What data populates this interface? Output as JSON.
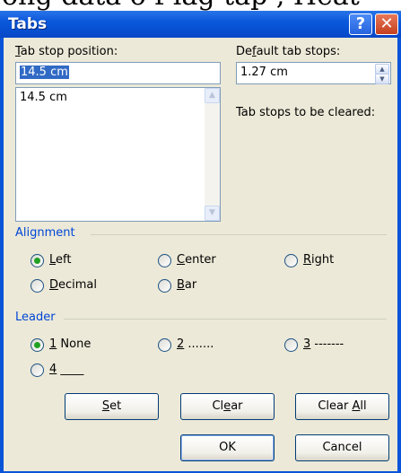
{
  "background_text": "ong data o f lag tap , Heat",
  "window": {
    "title": "Tabs",
    "help_glyph": "?",
    "close_glyph": "✕"
  },
  "tab_stop_position": {
    "label_prefix": "",
    "label_mnemonic": "T",
    "label_rest": "ab stop position:",
    "value": "14.5 cm",
    "list_items": [
      "14.5 cm"
    ]
  },
  "default_tab_stops": {
    "label_prefix": "De",
    "label_mnemonic": "f",
    "label_rest": "ault tab stops:",
    "value": "1.27 cm"
  },
  "tab_stops_cleared_label": "Tab stops to be cleared:",
  "alignment": {
    "group_label": "Alignment",
    "options": [
      {
        "mnemonic": "L",
        "rest": "eft",
        "checked": true
      },
      {
        "mnemonic": "C",
        "rest": "enter",
        "checked": false
      },
      {
        "mnemonic": "R",
        "rest": "ight",
        "checked": false
      },
      {
        "mnemonic": "D",
        "rest": "ecimal",
        "checked": false
      },
      {
        "mnemonic": "B",
        "rest": "ar",
        "checked": false
      }
    ]
  },
  "leader": {
    "group_label": "Leader",
    "options": [
      {
        "mnemonic": "1",
        "rest": " None",
        "checked": true
      },
      {
        "mnemonic": "2",
        "rest": " .......",
        "checked": false
      },
      {
        "mnemonic": "3",
        "rest": " -------",
        "checked": false
      },
      {
        "mnemonic": "4",
        "rest": " ____",
        "checked": false
      }
    ]
  },
  "buttons": {
    "set_mnemonic": "S",
    "set_rest": "et",
    "clear_prefix": "Cl",
    "clear_mnemonic": "e",
    "clear_rest": "ar",
    "clear_all_prefix": "Clear ",
    "clear_all_mnemonic": "A",
    "clear_all_rest": "ll",
    "ok": "OK",
    "cancel": "Cancel"
  },
  "colors": {
    "title_bar": "#0a54d8",
    "dialog_face": "#ece9d8",
    "group_label": "#0046d5",
    "selection": "#316ac5",
    "radio_dot": "#21a121"
  }
}
